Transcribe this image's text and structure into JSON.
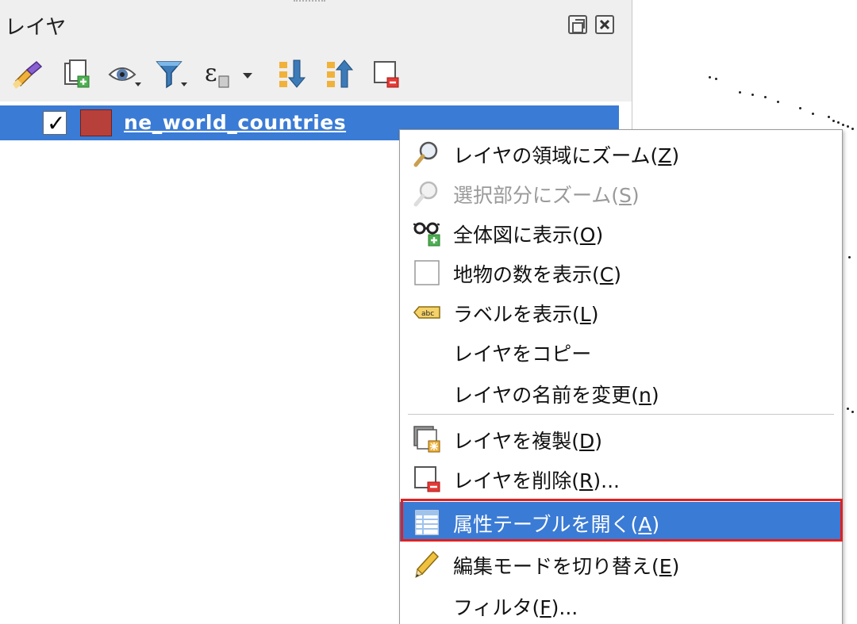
{
  "panel": {
    "title": "レイヤ",
    "toolbar_icons": [
      "paint-brush-icon",
      "add-group-icon",
      "eye-icon",
      "filter-icon",
      "expression-icon",
      "expand-all-icon",
      "collapse-all-icon",
      "remove-layer-icon"
    ]
  },
  "layer": {
    "name": "ne_world_countries",
    "checked": true,
    "color": "#b7403b"
  },
  "menu": {
    "items": [
      {
        "label": "レイヤの領域にズーム(",
        "key": "Z",
        "suffix": ")",
        "icon": "zoom-layer-icon",
        "enabled": true
      },
      {
        "label": "選択部分にズーム(",
        "key": "S",
        "suffix": ")",
        "icon": "zoom-selection-icon",
        "enabled": false
      },
      {
        "label": "全体図に表示(",
        "key": "O",
        "suffix": ")",
        "icon": "overview-icon",
        "enabled": true
      },
      {
        "label": "地物の数を表示(",
        "key": "C",
        "suffix": ")",
        "icon": "checkbox-icon",
        "enabled": true
      },
      {
        "label": "ラベルを表示(",
        "key": "L",
        "suffix": ")",
        "icon": "label-icon",
        "enabled": true
      },
      {
        "label": "レイヤをコピー",
        "key": "",
        "suffix": "",
        "icon": "",
        "enabled": true
      },
      {
        "label": "レイヤの名前を変更(",
        "key": "n",
        "suffix": ")",
        "icon": "",
        "enabled": true
      },
      {
        "label": "レイヤを複製(",
        "key": "D",
        "suffix": ")",
        "icon": "duplicate-layer-icon",
        "enabled": true
      },
      {
        "label": "レイヤを削除(",
        "key": "R",
        "suffix": ")...",
        "icon": "remove-layer-icon",
        "enabled": true
      },
      {
        "label": "属性テーブルを開く(",
        "key": "A",
        "suffix": ")",
        "icon": "attribute-table-icon",
        "enabled": true,
        "selected": true
      },
      {
        "label": "編集モードを切り替え(",
        "key": "E",
        "suffix": ")",
        "icon": "pencil-icon",
        "enabled": true
      },
      {
        "label": "フィルタ(",
        "key": "F",
        "suffix": ")...",
        "icon": "",
        "enabled": true
      }
    ]
  },
  "colors": {
    "selection": "#3a7bd5",
    "highlight_border": "#e02020"
  }
}
